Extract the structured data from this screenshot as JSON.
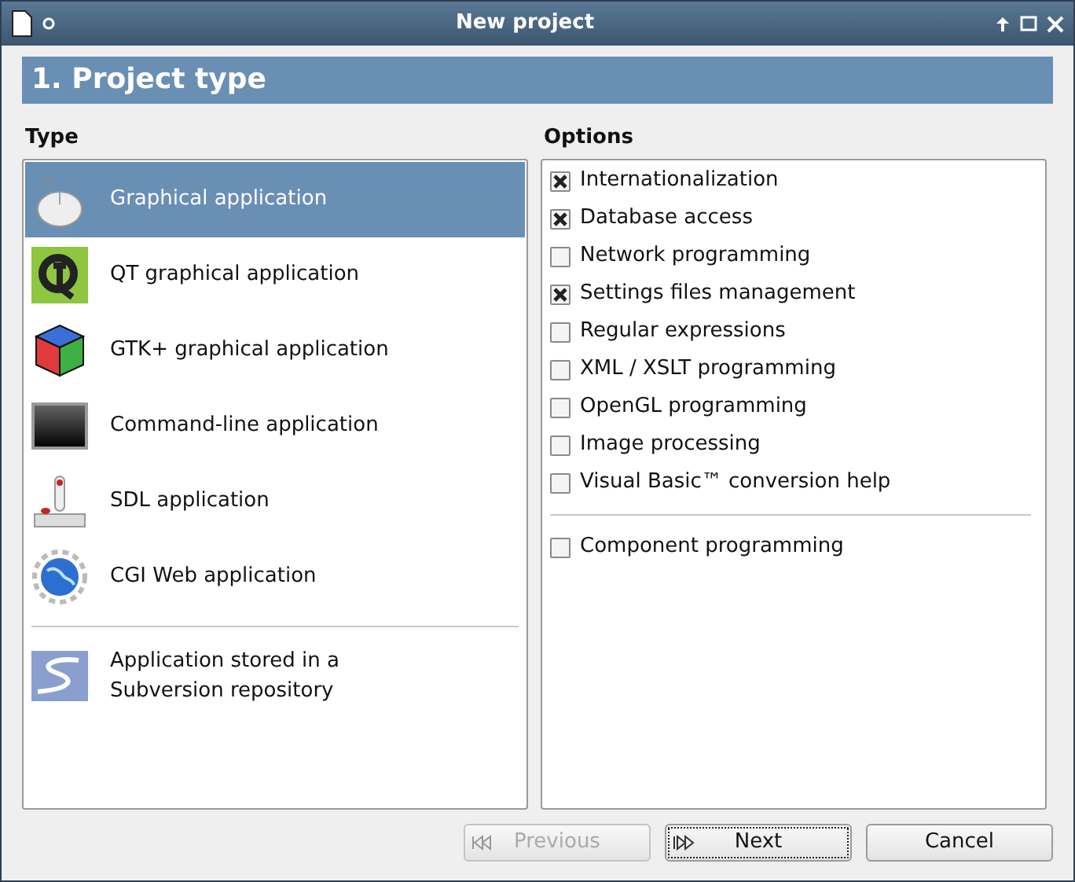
{
  "window": {
    "title": "New project"
  },
  "step_title": "1. Project type",
  "type_panel": {
    "heading": "Type",
    "groups": [
      {
        "items": [
          {
            "label": "Graphical application",
            "kind": "mouse",
            "selected": true
          },
          {
            "label": "QT graphical application",
            "kind": "qt",
            "selected": false
          },
          {
            "label": "GTK+ graphical application",
            "kind": "cube",
            "selected": false
          },
          {
            "label": "Command-line application",
            "kind": "terminal",
            "selected": false
          },
          {
            "label": "SDL application",
            "kind": "joystick",
            "selected": false
          },
          {
            "label": "CGI Web application",
            "kind": "globe",
            "selected": false
          }
        ]
      },
      {
        "items": [
          {
            "label": "Application stored in a Subversion repository",
            "kind": "svn",
            "selected": false
          }
        ]
      }
    ]
  },
  "options_panel": {
    "heading": "Options",
    "groups": [
      {
        "items": [
          {
            "label": "Internationalization",
            "checked": true
          },
          {
            "label": "Database access",
            "checked": true
          },
          {
            "label": "Network programming",
            "checked": false
          },
          {
            "label": "Settings files management",
            "checked": true
          },
          {
            "label": "Regular expressions",
            "checked": false
          },
          {
            "label": "XML / XSLT programming",
            "checked": false
          },
          {
            "label": "OpenGL programming",
            "checked": false
          },
          {
            "label": "Image processing",
            "checked": false
          },
          {
            "label": "Visual Basic™ conversion help",
            "checked": false
          }
        ]
      },
      {
        "items": [
          {
            "label": "Component programming",
            "checked": false
          }
        ]
      }
    ]
  },
  "buttons": [
    {
      "label": "Previous",
      "kind": "back",
      "disabled": true,
      "focused": false
    },
    {
      "label": "Next",
      "kind": "forward",
      "disabled": false,
      "focused": true
    },
    {
      "label": "Cancel",
      "disabled": false,
      "focused": false
    }
  ]
}
